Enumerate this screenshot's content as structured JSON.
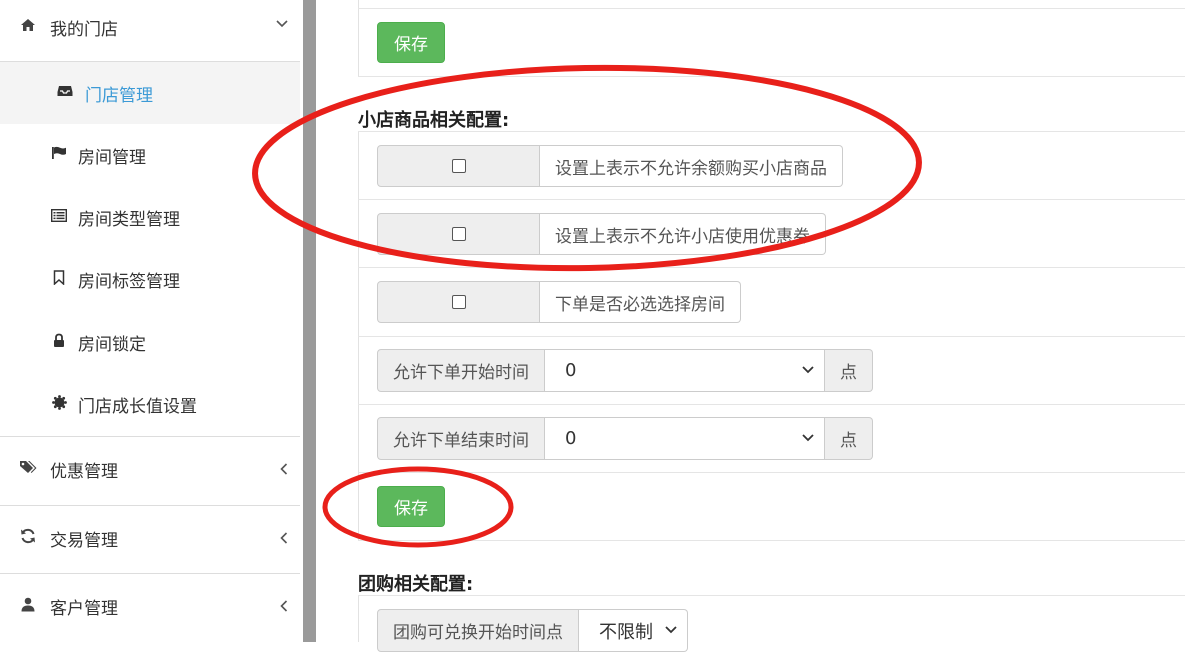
{
  "sidebar": {
    "groups": [
      {
        "label": "我的门店",
        "icon": "home-icon",
        "chevron": "⌄"
      },
      {
        "label": "优惠管理",
        "icon": "tags-icon",
        "chevron": "‹"
      },
      {
        "label": "交易管理",
        "icon": "refresh-icon",
        "chevron": "‹"
      },
      {
        "label": "客户管理",
        "icon": "user-icon",
        "chevron": "‹"
      }
    ],
    "items": [
      {
        "label": "门店管理",
        "icon": "inbox-icon",
        "active": true
      },
      {
        "label": "房间管理",
        "icon": "flag-icon"
      },
      {
        "label": "房间类型管理",
        "icon": "list-icon"
      },
      {
        "label": "房间标签管理",
        "icon": "bookmark-icon"
      },
      {
        "label": "房间锁定",
        "icon": "lock-icon"
      },
      {
        "label": "门店成长值设置",
        "icon": "certificate-icon"
      }
    ]
  },
  "main": {
    "top_save_label": "保存",
    "shop_section": {
      "title": "小店商品相关配置:",
      "checkboxes": [
        {
          "label": "设置上表示不允许余额购买小店商品",
          "checked": false
        },
        {
          "label": "设置上表示不允许小店使用优惠券",
          "checked": false
        },
        {
          "label": "下单是否必选选择房间",
          "checked": false
        }
      ],
      "selects": [
        {
          "label": "允许下单开始时间",
          "value": "0",
          "suffix": "点"
        },
        {
          "label": "允许下单结束时间",
          "value": "0",
          "suffix": "点"
        }
      ],
      "save_label": "保存"
    },
    "group_section": {
      "title": "团购相关配置:",
      "select": {
        "label": "团购可兑换开始时间点",
        "value": "不限制"
      }
    }
  },
  "colors": {
    "accent": "#3c9ad6",
    "save_button": "#5cb85c",
    "annotation": "#e8201a"
  }
}
